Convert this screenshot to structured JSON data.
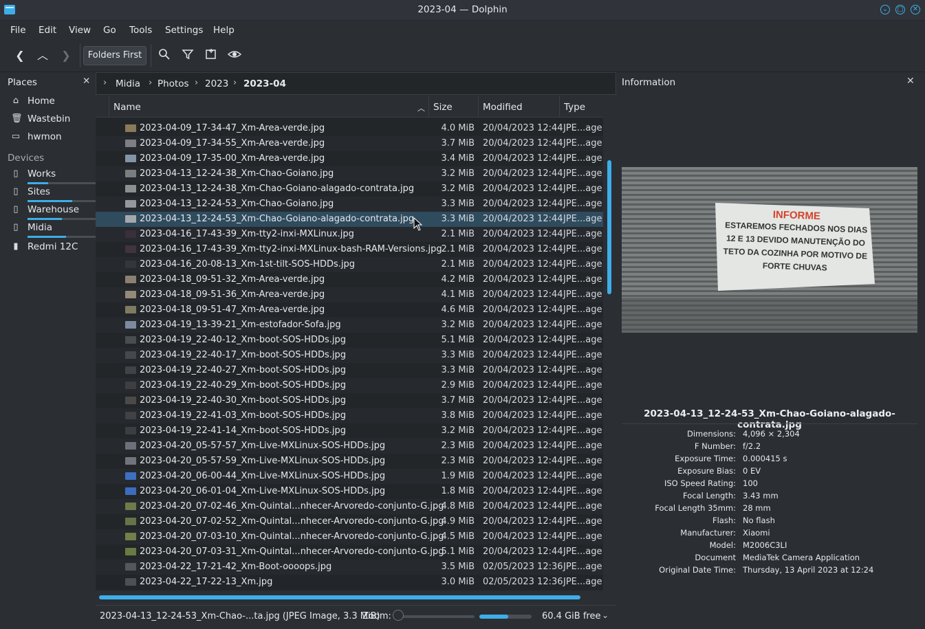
{
  "window": {
    "title": "2023-04 — Dolphin"
  },
  "menu": [
    "File",
    "Edit",
    "View",
    "Go",
    "Tools",
    "Settings",
    "Help"
  ],
  "toolbar": {
    "folders_first": "Folders First",
    "icons": [
      "back-icon",
      "up-icon",
      "forward-icon",
      "search-icon",
      "filter-icon",
      "new-folder-icon",
      "preview-icon"
    ]
  },
  "places": {
    "title": "Places",
    "items": [
      {
        "label": "Home",
        "icon": "home-icon"
      },
      {
        "label": "Wastebin",
        "icon": "trash-icon"
      },
      {
        "label": "hwmon",
        "icon": "folder-icon"
      }
    ],
    "devices_title": "Devices",
    "devices": [
      {
        "label": "Works",
        "usage": 0.3
      },
      {
        "label": "Sites",
        "usage": 0.66
      },
      {
        "label": "Warehouse",
        "usage": 0.51
      },
      {
        "label": "Midia",
        "usage": 0.57
      },
      {
        "label": "Redmi 12C",
        "usage": null
      }
    ]
  },
  "breadcrumb": [
    "Midia",
    "Photos",
    "2023",
    "2023-04"
  ],
  "columns": {
    "name": "Name",
    "size": "Size",
    "modified": "Modified",
    "type": "Type"
  },
  "files": [
    {
      "name": "2023-04-09_17-34-47_Xm-Area-verde.jpg",
      "size": "4.0 MiB",
      "modified": "20/04/2023 12:44",
      "type": "JPE...age",
      "color": "#8a7a5a"
    },
    {
      "name": "2023-04-09_17-34-55_Xm-Area-verde.jpg",
      "size": "3.7 MiB",
      "modified": "20/04/2023 12:44",
      "type": "JPE...age",
      "color": "#7d7f85"
    },
    {
      "name": "2023-04-09_17-35-00_Xm-Area-verde.jpg",
      "size": "3.4 MiB",
      "modified": "20/04/2023 12:44",
      "type": "JPE...age",
      "color": "#8494a8"
    },
    {
      "name": "2023-04-13_12-24-38_Xm-Chao-Goiano.jpg",
      "size": "3.2 MiB",
      "modified": "20/04/2023 12:44",
      "type": "JPE...age",
      "color": "#7b7e80"
    },
    {
      "name": "2023-04-13_12-24-38_Xm-Chao-Goiano-alagado-contrata.jpg",
      "size": "3.2 MiB",
      "modified": "20/04/2023 12:44",
      "type": "JPE...age",
      "color": "#8c8f90"
    },
    {
      "name": "2023-04-13_12-24-53_Xm-Chao-Goiano.jpg",
      "size": "3.3 MiB",
      "modified": "20/04/2023 12:44",
      "type": "JPE...age",
      "color": "#96999b"
    },
    {
      "name": "2023-04-13_12-24-53_Xm-Chao-Goiano-alagado-contrata.jpg",
      "size": "3.3 MiB",
      "modified": "20/04/2023 12:44",
      "type": "JPE...age",
      "color": "#a5a8aa",
      "selected": true
    },
    {
      "name": "2023-04-16_17-43-39_Xm-tty2-inxi-MXLinux.jpg",
      "size": "2.1 MiB",
      "modified": "20/04/2023 12:44",
      "type": "JPE...age",
      "color": "#3a2f3a"
    },
    {
      "name": "2023-04-16_17-43-39_Xm-tty2-inxi-MXLinux-bash-RAM-Versions.jpg",
      "size": "2.1 MiB",
      "modified": "20/04/2023 12:44",
      "type": "JPE...age",
      "color": "#40343f"
    },
    {
      "name": "2023-04-16_20-08-13_Xm-1st-tilt-SOS-HDDs.jpg",
      "size": "2.1 MiB",
      "modified": "20/04/2023 12:44",
      "type": "JPE...age",
      "color": "#35363a"
    },
    {
      "name": "2023-04-18_09-51-32_Xm-Area-verde.jpg",
      "size": "4.2 MiB",
      "modified": "20/04/2023 12:44",
      "type": "JPE...age",
      "color": "#8b8070"
    },
    {
      "name": "2023-04-18_09-51-36_Xm-Area-verde.jpg",
      "size": "4.1 MiB",
      "modified": "20/04/2023 12:44",
      "type": "JPE...age",
      "color": "#938a78"
    },
    {
      "name": "2023-04-18_09-51-47_Xm-Area-verde.jpg",
      "size": "4.6 MiB",
      "modified": "20/04/2023 12:44",
      "type": "JPE...age",
      "color": "#7f7a62"
    },
    {
      "name": "2023-04-19_13-39-21_Xm-estofador-Sofa.jpg",
      "size": "3.2 MiB",
      "modified": "20/04/2023 12:44",
      "type": "JPE...age",
      "color": "#7c8aa0"
    },
    {
      "name": "2023-04-19_22-40-12_Xm-boot-SOS-HDDs.jpg",
      "size": "5.1 MiB",
      "modified": "20/04/2023 12:44",
      "type": "JPE...age",
      "color": "#4a4c50"
    },
    {
      "name": "2023-04-19_22-40-17_Xm-boot-SOS-HDDs.jpg",
      "size": "3.3 MiB",
      "modified": "20/04/2023 12:44",
      "type": "JPE...age",
      "color": "#46484c"
    },
    {
      "name": "2023-04-19_22-40-27_Xm-boot-SOS-HDDs.jpg",
      "size": "3.3 MiB",
      "modified": "20/04/2023 12:44",
      "type": "JPE...age",
      "color": "#414347"
    },
    {
      "name": "2023-04-19_22-40-29_Xm-boot-SOS-HDDs.jpg",
      "size": "2.9 MiB",
      "modified": "20/04/2023 12:44",
      "type": "JPE...age",
      "color": "#3d3f43"
    },
    {
      "name": "2023-04-19_22-40-30_Xm-boot-SOS-HDDs.jpg",
      "size": "3.7 MiB",
      "modified": "20/04/2023 12:44",
      "type": "JPE...age",
      "color": "#4b4a48"
    },
    {
      "name": "2023-04-19_22-41-03_Xm-boot-SOS-HDDs.jpg",
      "size": "3.8 MiB",
      "modified": "20/04/2023 12:44",
      "type": "JPE...age",
      "color": "#404246"
    },
    {
      "name": "2023-04-19_22-41-14_Xm-boot-SOS-HDDs.jpg",
      "size": "3.2 MiB",
      "modified": "20/04/2023 12:44",
      "type": "JPE...age",
      "color": "#3c3e42"
    },
    {
      "name": "2023-04-20_05-57-57_Xm-Live-MXLinux-SOS-HDDs.jpg",
      "size": "2.3 MiB",
      "modified": "20/04/2023 12:44",
      "type": "JPE...age",
      "color": "#6c7078"
    },
    {
      "name": "2023-04-20_05-57-59_Xm-Live-MXLinux-SOS-HDDs.jpg",
      "size": "2.3 MiB",
      "modified": "20/04/2023 12:44",
      "type": "JPE...age",
      "color": "#70747c"
    },
    {
      "name": "2023-04-20_06-00-44_Xm-Live-MXLinux-SOS-HDDs.jpg",
      "size": "1.9 MiB",
      "modified": "20/04/2023 12:44",
      "type": "JPE...age",
      "color": "#3d6fc2"
    },
    {
      "name": "2023-04-20_06-01-04_Xm-Live-MXLinux-SOS-HDDs.jpg",
      "size": "1.8 MiB",
      "modified": "20/04/2023 12:44",
      "type": "JPE...age",
      "color": "#3b6cc0"
    },
    {
      "name": "2023-04-20_07-02-46_Xm-Quintal...nhecer-Arvoredo-conjunto-G.jpg",
      "size": "4.8 MiB",
      "modified": "20/04/2023 12:44",
      "type": "JPE...age",
      "color": "#6d7a4a"
    },
    {
      "name": "2023-04-20_07-02-52_Xm-Quintal...nhecer-Arvoredo-conjunto-G.jpg",
      "size": "4.9 MiB",
      "modified": "20/04/2023 12:44",
      "type": "JPE...age",
      "color": "#66744a"
    },
    {
      "name": "2023-04-20_07-03-10_Xm-Quintal...nhecer-Arvoredo-conjunto-G.jpg",
      "size": "4.5 MiB",
      "modified": "20/04/2023 12:44",
      "type": "JPE...age",
      "color": "#728049"
    },
    {
      "name": "2023-04-20_07-03-31_Xm-Quintal...nhecer-Arvoredo-conjunto-G.jpg",
      "size": "5.1 MiB",
      "modified": "20/04/2023 12:44",
      "type": "JPE...age",
      "color": "#6a7a45"
    },
    {
      "name": "2023-04-22_17-21-42_Xm-Boot-oooops.jpg",
      "size": "3.5 MiB",
      "modified": "02/05/2023 12:36",
      "type": "JPE...age",
      "color": "#55575a"
    },
    {
      "name": "2023-04-22_17-22-13_Xm.jpg",
      "size": "3.0 MiB",
      "modified": "02/05/2023 12:36",
      "type": "JPE...age",
      "color": "#4d4f52"
    }
  ],
  "status": {
    "text": "2023-04-13_12-24-53_Xm-Chao-...ta.jpg (JPEG Image, 3.3 MiB)",
    "zoom_label": "Zoom:",
    "zoom_level": 0.0,
    "space_free": "60.4 GiB free",
    "space_used_fraction": 0.55
  },
  "info": {
    "title": "Information",
    "filename": "2023-04-13_12-24-53_Xm-Chao-Goiano-alagado-contrata.jpg",
    "sign": {
      "heading": "INFORME",
      "lines": [
        "ESTAREMOS FECHADOS NOS DIAS",
        "12 E 13 DEVIDO MANUTENÇÃO DO",
        "TETO DA COZINHA POR MOTIVO DE",
        "FORTE CHUVAS"
      ]
    },
    "metadata": [
      {
        "key": "Dimensions:",
        "value": "4,096 × 2,304"
      },
      {
        "key": "F Number:",
        "value": "f/2.2"
      },
      {
        "key": "Exposure Time:",
        "value": "0.000415 s"
      },
      {
        "key": "Exposure Bias:",
        "value": "0 EV"
      },
      {
        "key": "ISO Speed Rating:",
        "value": "100"
      },
      {
        "key": "Focal Length:",
        "value": "3.43 mm"
      },
      {
        "key": "Focal Length 35mm:",
        "value": "28 mm"
      },
      {
        "key": "Flash:",
        "value": "No flash"
      },
      {
        "key": "Manufacturer:",
        "value": "Xiaomi"
      },
      {
        "key": "Model:",
        "value": "M2006C3LI"
      },
      {
        "key": "Document",
        "value": "MediaTek Camera Application"
      },
      {
        "key": "Original Date Time:",
        "value": "Thursday, 13 April 2023 at 12:24"
      }
    ]
  }
}
